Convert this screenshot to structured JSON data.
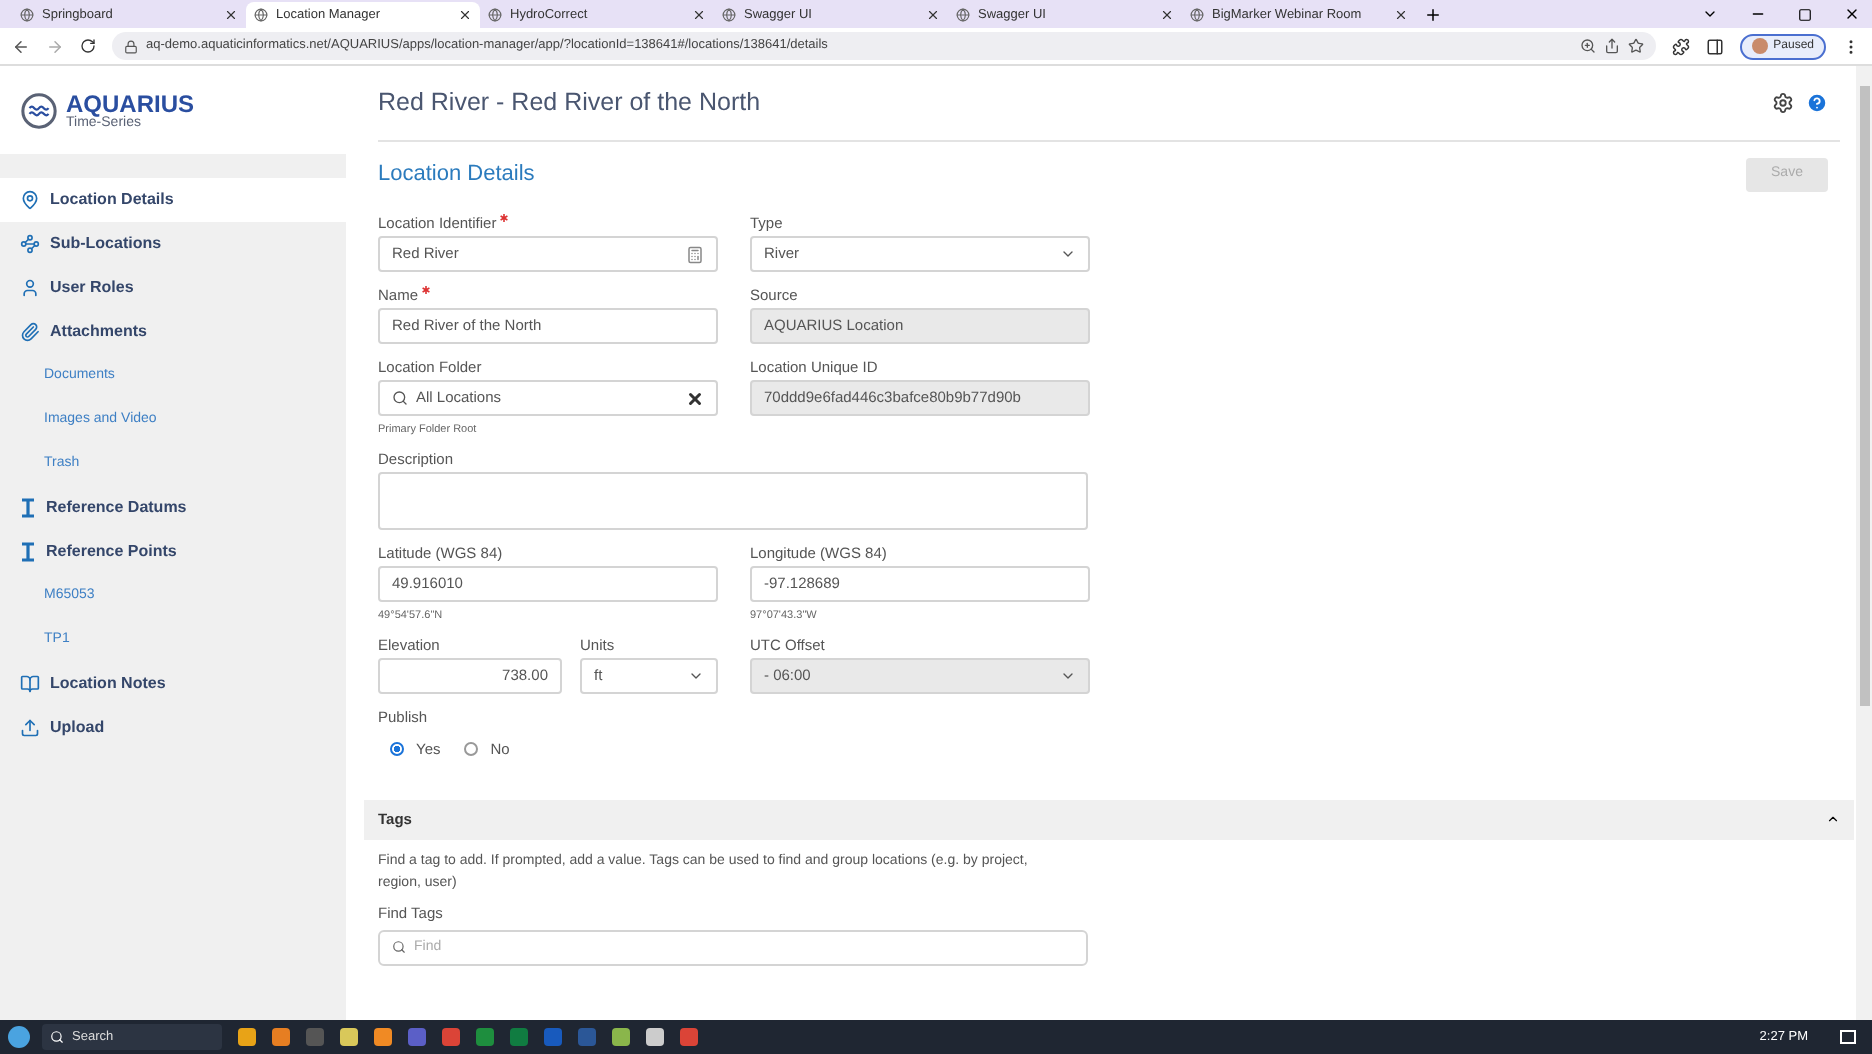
{
  "browser": {
    "tabs": [
      {
        "title": "Springboard",
        "selected": false
      },
      {
        "title": "Location Manager",
        "selected": true
      },
      {
        "title": "HydroCorrect",
        "selected": false
      },
      {
        "title": "Swagger UI",
        "selected": false
      },
      {
        "title": "Swagger UI",
        "selected": false
      },
      {
        "title": "BigMarker Webinar Room",
        "selected": false
      }
    ],
    "url": "aq-demo.aquaticinformatics.net/AQUARIUS/apps/location-manager/app/?locationId=138641#/locations/138641/details",
    "profile": "Paused"
  },
  "logo": {
    "name": "AQUARIUS",
    "subtitle": "Time-Series"
  },
  "sidebar": {
    "items": [
      {
        "label": "Location Details",
        "kind": "section",
        "selected": true
      },
      {
        "label": "Sub-Locations",
        "kind": "section",
        "selected": false
      },
      {
        "label": "User Roles",
        "kind": "section",
        "selected": false
      },
      {
        "label": "Attachments",
        "kind": "section",
        "selected": false
      },
      {
        "label": "Documents",
        "kind": "sub",
        "selected": false
      },
      {
        "label": "Images and Video",
        "kind": "sub",
        "selected": false
      },
      {
        "label": "Trash",
        "kind": "sub",
        "selected": false
      },
      {
        "label": "Reference Datums",
        "kind": "section",
        "selected": false
      },
      {
        "label": "Reference Points",
        "kind": "section",
        "selected": false
      },
      {
        "label": "M65053",
        "kind": "sub",
        "selected": false
      },
      {
        "label": "TP1",
        "kind": "sub",
        "selected": false
      },
      {
        "label": "Location Notes",
        "kind": "section",
        "selected": false
      },
      {
        "label": "Upload",
        "kind": "section",
        "selected": false
      }
    ]
  },
  "header": {
    "title": "Red River - Red River of the North"
  },
  "section": {
    "title": "Location Details",
    "save": "Save",
    "save_disabled": true
  },
  "form": {
    "rows": [
      [
        {
          "label": "Location Identifier",
          "required": true,
          "kind": "text",
          "value": "Red River"
        },
        {
          "label": "Type",
          "required": false,
          "kind": "select",
          "value": "River"
        }
      ],
      [
        {
          "label": "Name",
          "required": true,
          "kind": "text",
          "value": "Red River of the North"
        },
        {
          "label": "Source",
          "required": false,
          "kind": "readonly",
          "value": "AQUARIUS Location"
        }
      ],
      [
        {
          "label": "Location Folder",
          "required": false,
          "kind": "search",
          "value": "All Locations",
          "hint": "Primary Folder Root"
        },
        {
          "label": "Location Unique ID",
          "required": false,
          "kind": "readonly",
          "value": "70ddd9e6fad446c3bafce80b9b77d90b"
        }
      ],
      [
        {
          "label": "Description",
          "required": false,
          "kind": "textarea"
        }
      ],
      [
        {
          "label": "Latitude (WGS 84)",
          "required": false,
          "kind": "text",
          "value": "49.916010",
          "hint": "49°54'57.6\"N"
        },
        {
          "label": "Longitude (WGS 84)",
          "required": false,
          "kind": "text",
          "value": "-97.128689",
          "hint": "97°07'43.3\"W"
        }
      ],
      [
        {
          "label": "Elevation",
          "required": false,
          "kind": "number",
          "value": "738.00"
        },
        {
          "label": "Units",
          "required": false,
          "kind": "select",
          "value": "ft"
        },
        {
          "label": "UTC Offset",
          "required": false,
          "kind": "readonly-select",
          "value": "- 06:00"
        }
      ]
    ],
    "publish": {
      "label": "Publish",
      "options": [
        {
          "label": "Yes",
          "selected": true
        },
        {
          "label": "No",
          "selected": false
        }
      ]
    }
  },
  "tags": {
    "title": "Tags",
    "expanded": true,
    "help": "Find a tag to add. If prompted, add a value. Tags can be used to find and group locations (e.g. by project, region, user)",
    "find_label": "Find Tags",
    "find_placeholder": "Find"
  },
  "taskbar": {
    "search": "Search",
    "time": "2:27 PM"
  }
}
